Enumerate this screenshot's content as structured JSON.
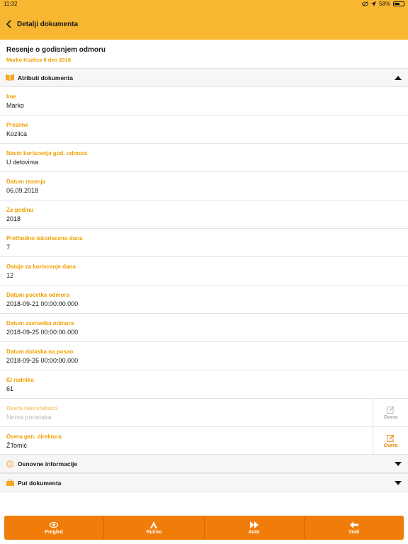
{
  "status_bar": {
    "time": "11:32",
    "battery": "58%"
  },
  "nav": {
    "title": "Detalji dokumenta"
  },
  "document": {
    "title": "Resenje o godisnjem odmoru",
    "subtitle": "Marko Kozlica II deo 2018"
  },
  "sections": {
    "atributi": "Atributi dokumenta",
    "osnovne": "Osnovne informacije",
    "put": "Put dokumenta"
  },
  "fields": [
    {
      "label": "Ime",
      "value": "Marko"
    },
    {
      "label": "Prezime",
      "value": "Kozlica"
    },
    {
      "label": "Nacin koriscenja god. odmora",
      "value": "U delovima"
    },
    {
      "label": "Datum resenja",
      "value": "06.09.2018"
    },
    {
      "label": "Za godinu",
      "value": "2018"
    },
    {
      "label": "Prethodno iskorisceno dana",
      "value": "7"
    },
    {
      "label": "Ostaje za koriscenje dana",
      "value": "12"
    },
    {
      "label": "Datum pocetka odmora",
      "value": "2018-09-21 00:00:00.000"
    },
    {
      "label": "Datum zavrsetka odmora",
      "value": "2018-09-25 00:00:00.000"
    },
    {
      "label": "Datum dolaska na posao",
      "value": "2018-09-26 00:00:00.000"
    },
    {
      "label": "ID radnika",
      "value": "61"
    },
    {
      "label": "Overa rukovodioca",
      "value": "Nema podataka",
      "action": "Overa"
    },
    {
      "label": "Overa gen. direktora",
      "value": "ŽTomić",
      "action": "Overa"
    }
  ],
  "bottom_tabs": [
    {
      "label": "Pregled",
      "icon": "eye-icon"
    },
    {
      "label": "Ručno",
      "icon": "hand-icon"
    },
    {
      "label": "Auto",
      "icon": "fast-forward-icon"
    },
    {
      "label": "Vrati",
      "icon": "arrow-left-icon"
    }
  ],
  "colors": {
    "accent": "#f7b731",
    "label": "#f0a000",
    "bottom_bar": "#f07d0a"
  }
}
